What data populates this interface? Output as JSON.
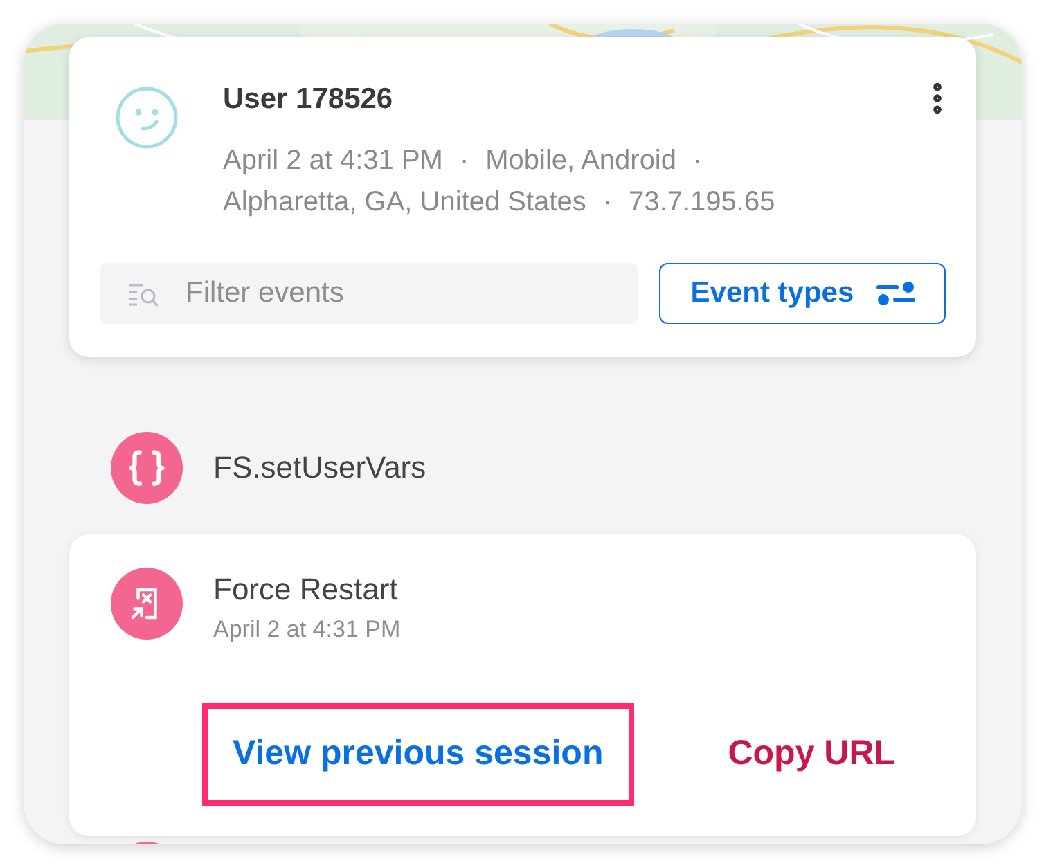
{
  "user": {
    "name": "User 178526",
    "meta_lines": [
      [
        "April 2 at 4:31 PM",
        "·",
        "Mobile, Android",
        "·"
      ],
      [
        "Alpharetta, GA, United States",
        "·",
        "73.7.195.65"
      ]
    ]
  },
  "filter": {
    "placeholder": "Filter events"
  },
  "event_types_button": {
    "label": "Event types"
  },
  "events": [
    {
      "kind": "api",
      "title": "FS.setUserVars"
    },
    {
      "kind": "crash",
      "title": "Force Restart",
      "time": "April 2 at 4:31 PM",
      "actions": [
        {
          "kind": "primary",
          "label": "View previous session",
          "highlighted": true
        },
        {
          "kind": "danger",
          "label": "Copy URL",
          "highlighted": false
        }
      ]
    },
    {
      "kind": "api"
    }
  ]
}
